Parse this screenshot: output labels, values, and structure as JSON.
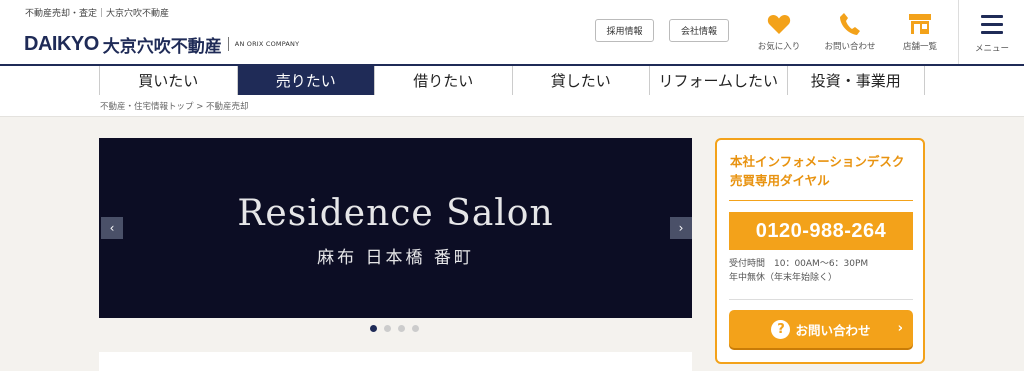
{
  "header": {
    "tagline": "不動産売却・査定｜大京穴吹不動産",
    "logo_mark": "DAIKYO",
    "logo_jp": "大京穴吹不動産",
    "logo_orix": "AN ORIX COMPANY",
    "recruit_label": "採用情報",
    "company_label": "会社情報",
    "favorites_label": "お気に入り",
    "contact_label": "お問い合わせ",
    "stores_label": "店舗一覧",
    "menu_label": "メニュー"
  },
  "nav": {
    "tabs": [
      {
        "label": "買いたい"
      },
      {
        "label": "売りたい"
      },
      {
        "label": "借りたい"
      },
      {
        "label": "貸したい"
      },
      {
        "label": "リフォームしたい"
      },
      {
        "label": "投資・事業用"
      }
    ],
    "active_index": 1
  },
  "breadcrumb": "不動産・住宅情報トップ > 不動産売却",
  "slider": {
    "title": "Residence Salon",
    "subtitle": "麻布 日本橋 番町",
    "prev_icon": "chevron-left-icon",
    "next_icon": "chevron-right-icon",
    "slide_count": 4,
    "current_slide": 1
  },
  "info": {
    "title_line1": "本社インフォメーションデスク",
    "title_line2": "売買専用ダイヤル",
    "phone": "0120-988-264",
    "hours_line1": "受付時間　10：00AM〜6：30PM",
    "hours_line2": "年中無休（年末年始除く）",
    "contact_button": "お問い合わせ"
  },
  "colors": {
    "brand_navy": "#1f2b57",
    "accent_orange": "#f3a21a",
    "slide_bg": "#0c0d24"
  }
}
